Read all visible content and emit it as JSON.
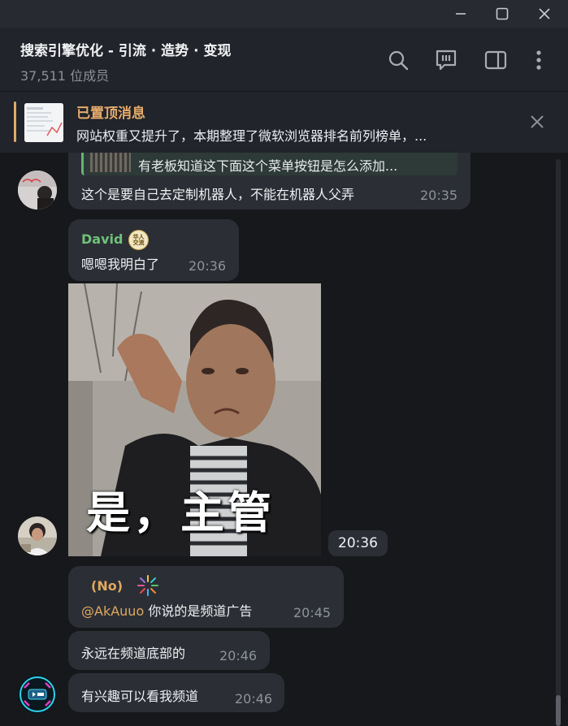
{
  "window": {
    "controls": [
      "minimize-icon",
      "maximize-icon",
      "close-icon"
    ]
  },
  "header": {
    "title": "搜索引擎优化 - 引流 · 造势 · 变现",
    "subtitle": "37,511 位成员",
    "icons": [
      "search-icon",
      "discussion-icon",
      "sidebar-toggle-icon",
      "more-vertical-icon"
    ]
  },
  "pinned": {
    "title": "已置顶消息",
    "text": "网站权重又提升了，本期整理了微软浏览器排名前列榜单，..."
  },
  "messages": {
    "m1": {
      "reply_text": "有老板知道这下面这个菜单按钮是怎么添加...",
      "text": "这个是要自己去定制机器人，不能在机器人父弄",
      "time": "20:35"
    },
    "m2": {
      "sender": "David",
      "badge": "华人\n交流",
      "text": "嗯嗯我明白了",
      "time": "20:36"
    },
    "m3": {
      "caption": "是，主管",
      "time": "20:36"
    },
    "m4": {
      "sender": "(No)",
      "mention": "@AkAuuo",
      "text": " 你说的是频道广告",
      "time": "20:45"
    },
    "m5": {
      "text": "永远在频道底部的",
      "time": "20:46"
    },
    "m6": {
      "text": "有兴趣可以看我频道",
      "time": "20:46"
    }
  },
  "colors": {
    "accent": "#e1a96b",
    "sender_green": "#6fc27a",
    "sender_orange": "#e1a760",
    "bubble": "#2b2f35",
    "background": "#17181c"
  }
}
